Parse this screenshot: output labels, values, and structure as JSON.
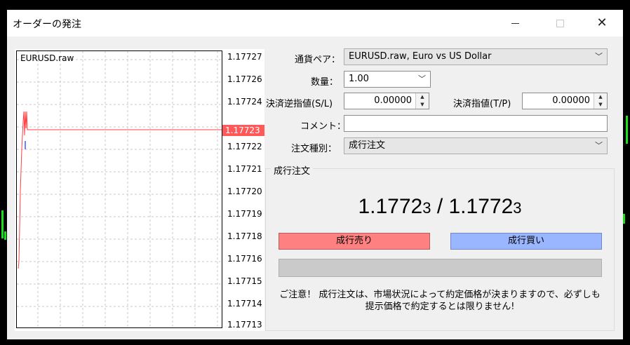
{
  "window": {
    "title": "オーダーの発注"
  },
  "chart": {
    "symbol": "EURUSD.raw",
    "price_axis": [
      "1.17727",
      "1.17726",
      "1.17724",
      "1.17722",
      "1.17721",
      "1.17720",
      "1.17719",
      "1.17718",
      "1.17716",
      "1.17715",
      "1.17714",
      "1.17713"
    ],
    "current_price": "1.17723"
  },
  "form": {
    "pair_label": "通貨ペア：",
    "pair_value": "EURUSD.raw, Euro vs US Dollar",
    "volume_label": "数量：",
    "volume_value": "1.00",
    "sl_label": "決済逆指値(S/L)",
    "sl_value": "0.00000",
    "tp_label": "決済指値(T/P)",
    "tp_value": "0.00000",
    "comment_label": "コメント：",
    "comment_value": "",
    "type_label": "注文種別：",
    "type_value": "成行注文"
  },
  "market": {
    "group_title": "成行注文",
    "bid_main": "1.1772",
    "bid_last": "3",
    "sep": " / ",
    "ask_main": "1.1772",
    "ask_last": "3",
    "sell_label": "成行売り",
    "buy_label": "成行買い",
    "notice_line1": "ご注意！ 成行注文は、市場状況によって約定価格が決まりますので、必ずしも",
    "notice_line2": "提示価格で約定するとは限りません!"
  },
  "colors": {
    "sell": "#ff8080",
    "buy": "#9ab6ff",
    "current_price_tag": "#ff5a5a"
  }
}
